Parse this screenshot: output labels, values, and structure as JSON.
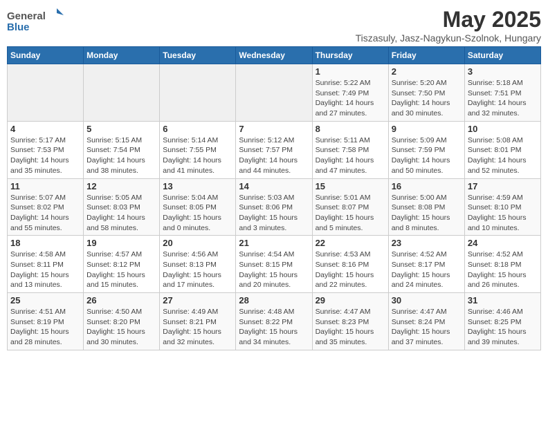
{
  "header": {
    "logo_general": "General",
    "logo_blue": "Blue",
    "month": "May 2025",
    "location": "Tiszasuly, Jasz-Nagykun-Szolnok, Hungary"
  },
  "weekdays": [
    "Sunday",
    "Monday",
    "Tuesday",
    "Wednesday",
    "Thursday",
    "Friday",
    "Saturday"
  ],
  "weeks": [
    [
      {
        "day": "",
        "sunrise": "",
        "sunset": "",
        "daylight": ""
      },
      {
        "day": "",
        "sunrise": "",
        "sunset": "",
        "daylight": ""
      },
      {
        "day": "",
        "sunrise": "",
        "sunset": "",
        "daylight": ""
      },
      {
        "day": "",
        "sunrise": "",
        "sunset": "",
        "daylight": ""
      },
      {
        "day": "1",
        "sunrise": "Sunrise: 5:22 AM",
        "sunset": "Sunset: 7:49 PM",
        "daylight": "Daylight: 14 hours and 27 minutes."
      },
      {
        "day": "2",
        "sunrise": "Sunrise: 5:20 AM",
        "sunset": "Sunset: 7:50 PM",
        "daylight": "Daylight: 14 hours and 30 minutes."
      },
      {
        "day": "3",
        "sunrise": "Sunrise: 5:18 AM",
        "sunset": "Sunset: 7:51 PM",
        "daylight": "Daylight: 14 hours and 32 minutes."
      }
    ],
    [
      {
        "day": "4",
        "sunrise": "Sunrise: 5:17 AM",
        "sunset": "Sunset: 7:53 PM",
        "daylight": "Daylight: 14 hours and 35 minutes."
      },
      {
        "day": "5",
        "sunrise": "Sunrise: 5:15 AM",
        "sunset": "Sunset: 7:54 PM",
        "daylight": "Daylight: 14 hours and 38 minutes."
      },
      {
        "day": "6",
        "sunrise": "Sunrise: 5:14 AM",
        "sunset": "Sunset: 7:55 PM",
        "daylight": "Daylight: 14 hours and 41 minutes."
      },
      {
        "day": "7",
        "sunrise": "Sunrise: 5:12 AM",
        "sunset": "Sunset: 7:57 PM",
        "daylight": "Daylight: 14 hours and 44 minutes."
      },
      {
        "day": "8",
        "sunrise": "Sunrise: 5:11 AM",
        "sunset": "Sunset: 7:58 PM",
        "daylight": "Daylight: 14 hours and 47 minutes."
      },
      {
        "day": "9",
        "sunrise": "Sunrise: 5:09 AM",
        "sunset": "Sunset: 7:59 PM",
        "daylight": "Daylight: 14 hours and 50 minutes."
      },
      {
        "day": "10",
        "sunrise": "Sunrise: 5:08 AM",
        "sunset": "Sunset: 8:01 PM",
        "daylight": "Daylight: 14 hours and 52 minutes."
      }
    ],
    [
      {
        "day": "11",
        "sunrise": "Sunrise: 5:07 AM",
        "sunset": "Sunset: 8:02 PM",
        "daylight": "Daylight: 14 hours and 55 minutes."
      },
      {
        "day": "12",
        "sunrise": "Sunrise: 5:05 AM",
        "sunset": "Sunset: 8:03 PM",
        "daylight": "Daylight: 14 hours and 58 minutes."
      },
      {
        "day": "13",
        "sunrise": "Sunrise: 5:04 AM",
        "sunset": "Sunset: 8:05 PM",
        "daylight": "Daylight: 15 hours and 0 minutes."
      },
      {
        "day": "14",
        "sunrise": "Sunrise: 5:03 AM",
        "sunset": "Sunset: 8:06 PM",
        "daylight": "Daylight: 15 hours and 3 minutes."
      },
      {
        "day": "15",
        "sunrise": "Sunrise: 5:01 AM",
        "sunset": "Sunset: 8:07 PM",
        "daylight": "Daylight: 15 hours and 5 minutes."
      },
      {
        "day": "16",
        "sunrise": "Sunrise: 5:00 AM",
        "sunset": "Sunset: 8:08 PM",
        "daylight": "Daylight: 15 hours and 8 minutes."
      },
      {
        "day": "17",
        "sunrise": "Sunrise: 4:59 AM",
        "sunset": "Sunset: 8:10 PM",
        "daylight": "Daylight: 15 hours and 10 minutes."
      }
    ],
    [
      {
        "day": "18",
        "sunrise": "Sunrise: 4:58 AM",
        "sunset": "Sunset: 8:11 PM",
        "daylight": "Daylight: 15 hours and 13 minutes."
      },
      {
        "day": "19",
        "sunrise": "Sunrise: 4:57 AM",
        "sunset": "Sunset: 8:12 PM",
        "daylight": "Daylight: 15 hours and 15 minutes."
      },
      {
        "day": "20",
        "sunrise": "Sunrise: 4:56 AM",
        "sunset": "Sunset: 8:13 PM",
        "daylight": "Daylight: 15 hours and 17 minutes."
      },
      {
        "day": "21",
        "sunrise": "Sunrise: 4:54 AM",
        "sunset": "Sunset: 8:15 PM",
        "daylight": "Daylight: 15 hours and 20 minutes."
      },
      {
        "day": "22",
        "sunrise": "Sunrise: 4:53 AM",
        "sunset": "Sunset: 8:16 PM",
        "daylight": "Daylight: 15 hours and 22 minutes."
      },
      {
        "day": "23",
        "sunrise": "Sunrise: 4:52 AM",
        "sunset": "Sunset: 8:17 PM",
        "daylight": "Daylight: 15 hours and 24 minutes."
      },
      {
        "day": "24",
        "sunrise": "Sunrise: 4:52 AM",
        "sunset": "Sunset: 8:18 PM",
        "daylight": "Daylight: 15 hours and 26 minutes."
      }
    ],
    [
      {
        "day": "25",
        "sunrise": "Sunrise: 4:51 AM",
        "sunset": "Sunset: 8:19 PM",
        "daylight": "Daylight: 15 hours and 28 minutes."
      },
      {
        "day": "26",
        "sunrise": "Sunrise: 4:50 AM",
        "sunset": "Sunset: 8:20 PM",
        "daylight": "Daylight: 15 hours and 30 minutes."
      },
      {
        "day": "27",
        "sunrise": "Sunrise: 4:49 AM",
        "sunset": "Sunset: 8:21 PM",
        "daylight": "Daylight: 15 hours and 32 minutes."
      },
      {
        "day": "28",
        "sunrise": "Sunrise: 4:48 AM",
        "sunset": "Sunset: 8:22 PM",
        "daylight": "Daylight: 15 hours and 34 minutes."
      },
      {
        "day": "29",
        "sunrise": "Sunrise: 4:47 AM",
        "sunset": "Sunset: 8:23 PM",
        "daylight": "Daylight: 15 hours and 35 minutes."
      },
      {
        "day": "30",
        "sunrise": "Sunrise: 4:47 AM",
        "sunset": "Sunset: 8:24 PM",
        "daylight": "Daylight: 15 hours and 37 minutes."
      },
      {
        "day": "31",
        "sunrise": "Sunrise: 4:46 AM",
        "sunset": "Sunset: 8:25 PM",
        "daylight": "Daylight: 15 hours and 39 minutes."
      }
    ]
  ]
}
